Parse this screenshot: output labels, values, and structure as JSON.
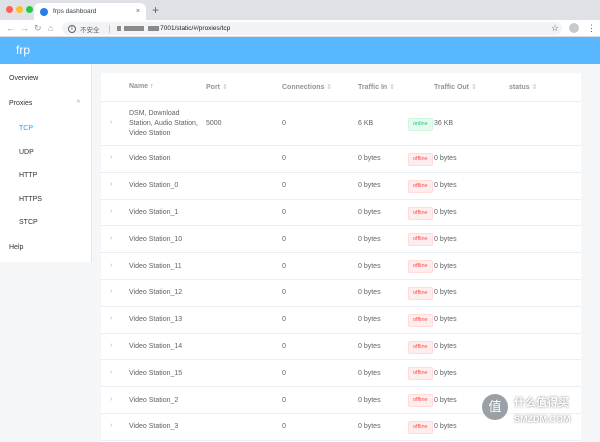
{
  "browser": {
    "tab_title": "frps dashboard",
    "tab_close": "×",
    "new_tab": "+",
    "insecure_label": "不安全",
    "url_suffix": "7001/static/#/proxies/tcp"
  },
  "app": {
    "brand": "frp"
  },
  "sidebar": {
    "overview": "Overview",
    "proxies": "Proxies",
    "proxies_chevron": "^",
    "sub": [
      "TCP",
      "UDP",
      "HTTP",
      "HTTPS",
      "STCP"
    ],
    "active": "TCP",
    "help": "Help"
  },
  "table": {
    "headers": {
      "name": "Name",
      "port": "Port",
      "connections": "Connections",
      "traffic_in": "Traffic In",
      "traffic_out": "Traffic Out",
      "status": "status"
    },
    "rows": [
      {
        "name": "DSM, Download Station, Audio Station, Video Station",
        "port": "5000",
        "connections": "0",
        "traffic_in": "6 KB",
        "traffic_out": "36 KB",
        "status": "online"
      },
      {
        "name": "Video Station",
        "port": "",
        "connections": "0",
        "traffic_in": "0 bytes",
        "traffic_out": "0 bytes",
        "status": "offline"
      },
      {
        "name": "Video Station_0",
        "port": "",
        "connections": "0",
        "traffic_in": "0 bytes",
        "traffic_out": "0 bytes",
        "status": "offline"
      },
      {
        "name": "Video Station_1",
        "port": "",
        "connections": "0",
        "traffic_in": "0 bytes",
        "traffic_out": "0 bytes",
        "status": "offline"
      },
      {
        "name": "Video Station_10",
        "port": "",
        "connections": "0",
        "traffic_in": "0 bytes",
        "traffic_out": "0 bytes",
        "status": "offline"
      },
      {
        "name": "Video Station_11",
        "port": "",
        "connections": "0",
        "traffic_in": "0 bytes",
        "traffic_out": "0 bytes",
        "status": "offline"
      },
      {
        "name": "Video Station_12",
        "port": "",
        "connections": "0",
        "traffic_in": "0 bytes",
        "traffic_out": "0 bytes",
        "status": "offline"
      },
      {
        "name": "Video Station_13",
        "port": "",
        "connections": "0",
        "traffic_in": "0 bytes",
        "traffic_out": "0 bytes",
        "status": "offline"
      },
      {
        "name": "Video Station_14",
        "port": "",
        "connections": "0",
        "traffic_in": "0 bytes",
        "traffic_out": "0 bytes",
        "status": "offline"
      },
      {
        "name": "Video Station_15",
        "port": "",
        "connections": "0",
        "traffic_in": "0 bytes",
        "traffic_out": "0 bytes",
        "status": "offline"
      },
      {
        "name": "Video Station_2",
        "port": "",
        "connections": "0",
        "traffic_in": "0 bytes",
        "traffic_out": "0 bytes",
        "status": "offline"
      },
      {
        "name": "Video Station_3",
        "port": "",
        "connections": "0",
        "traffic_in": "0 bytes",
        "traffic_out": "0 bytes",
        "status": "offline"
      }
    ]
  },
  "watermark": {
    "cn": "什么值得买",
    "en": "SMZDM.COM",
    "logo": "值"
  },
  "icons": {
    "back": "back-arrow-icon",
    "forward": "forward-arrow-icon",
    "reload": "reload-icon",
    "home": "home-icon",
    "info": "info-icon",
    "bookmark": "star-icon",
    "expand": "chevron-right-icon",
    "sort": "sort-icon"
  },
  "colors": {
    "header": "#58b7ff",
    "active": "#20a0ff",
    "online": "#13ce66",
    "offline": "#ff4949"
  }
}
